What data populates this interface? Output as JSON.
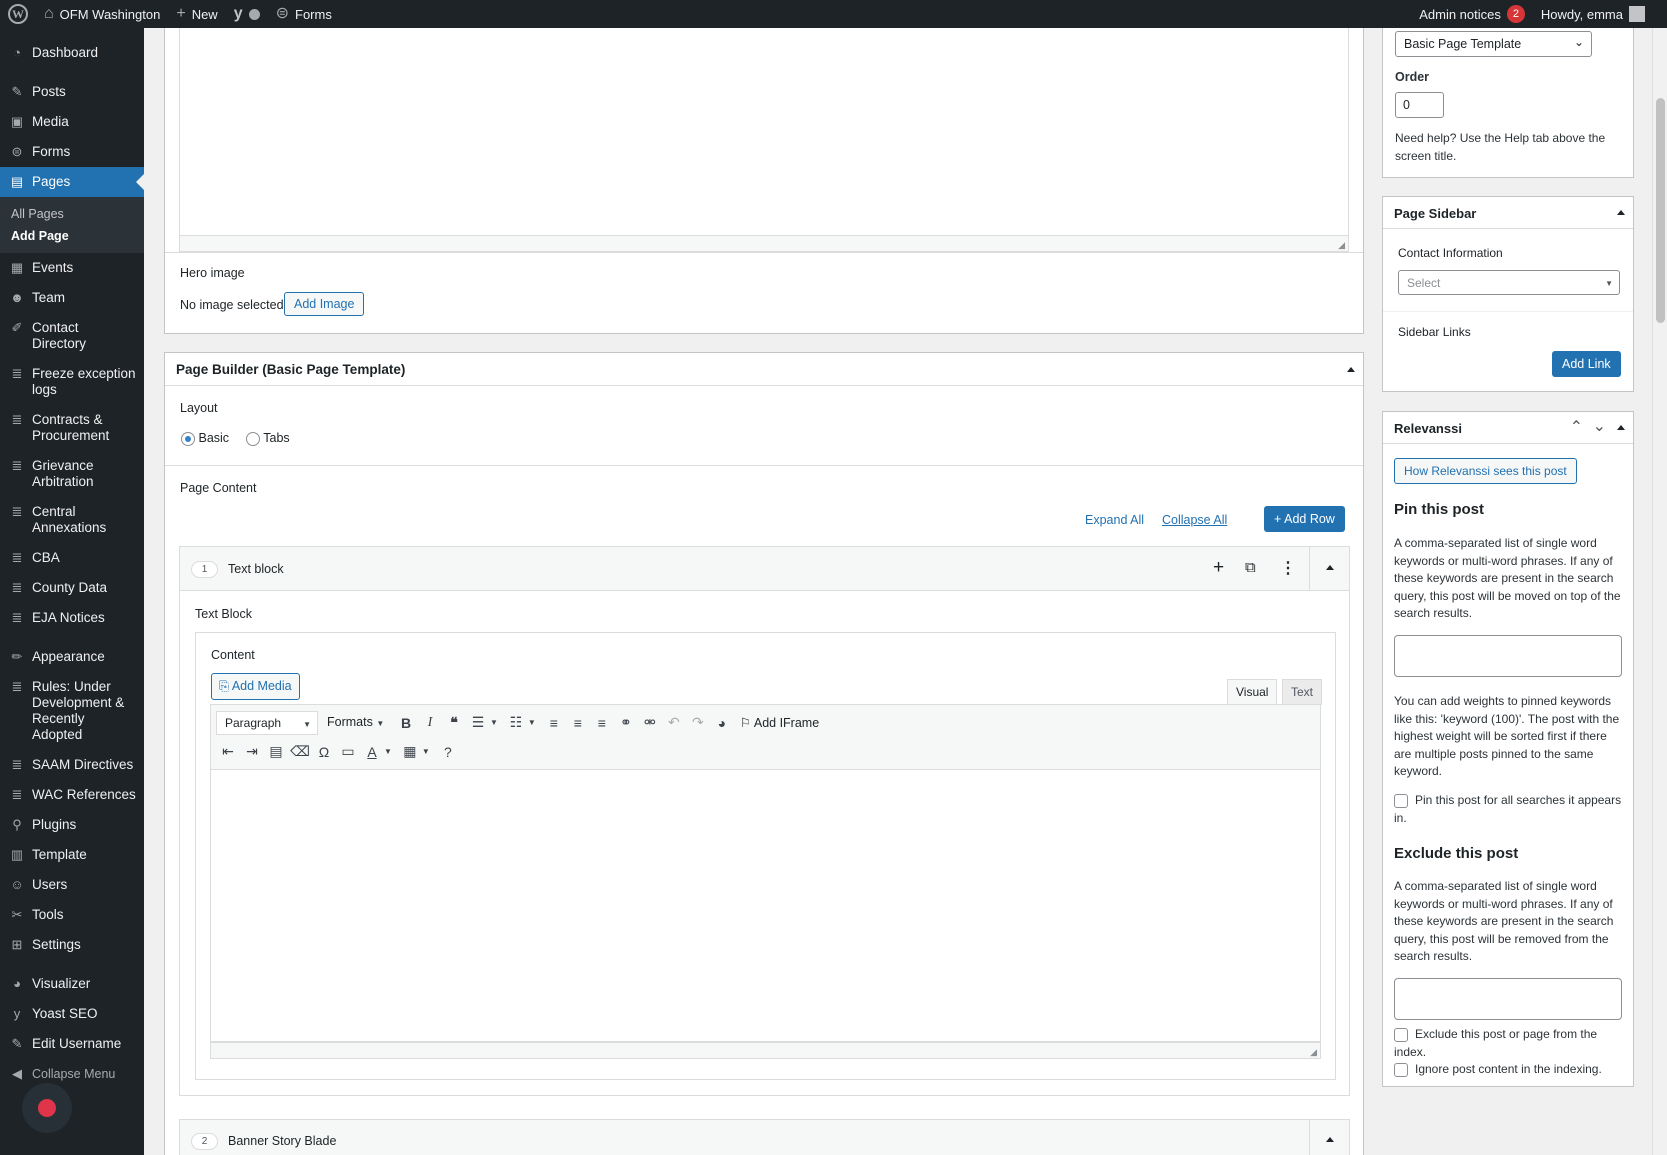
{
  "admin_bar": {
    "site_name": "OFM Washington",
    "new_label": "New",
    "forms_label": "Forms",
    "admin_notices_label": "Admin notices",
    "admin_notices_count": "2",
    "howdy": "Howdy, emma"
  },
  "menu": {
    "dashboard": "Dashboard",
    "posts": "Posts",
    "media": "Media",
    "forms": "Forms",
    "pages": "Pages",
    "all_pages": "All Pages",
    "add_page": "Add Page",
    "events": "Events",
    "team": "Team",
    "contact_directory": "Contact Directory",
    "freeze_logs": "Freeze exception logs",
    "contracts": "Contracts & Procurement",
    "grievance": "Grievance Arbitration",
    "central": "Central Annexations",
    "cba": "CBA",
    "county": "County Data",
    "eja": "EJA Notices",
    "appearance": "Appearance",
    "rules": "Rules: Under Development & Recently Adopted",
    "saam": "SAAM Directives",
    "wac": "WAC References",
    "plugins": "Plugins",
    "template": "Template",
    "users": "Users",
    "tools": "Tools",
    "settings": "Settings",
    "visualizer": "Visualizer",
    "yoast": "Yoast SEO",
    "edit_username": "Edit Username",
    "collapse": "Collapse Menu"
  },
  "hero": {
    "label": "Hero image",
    "status": "No image selected",
    "add_button": "Add Image"
  },
  "page_builder": {
    "title": "Page Builder (Basic Page Template)",
    "layout_label": "Layout",
    "layout_options": [
      "Basic",
      "Tabs"
    ],
    "layout_selected": "Basic",
    "page_content_label": "Page Content",
    "expand_all": "Expand All",
    "collapse_all": "Collapse All",
    "add_row": "Add Row",
    "rows": [
      {
        "index": "1",
        "name": "Text block"
      },
      {
        "index": "2",
        "name": "Banner Story Blade"
      }
    ],
    "text_block_label": "Text Block",
    "content_label": "Content",
    "add_media": "Add Media",
    "tab_visual": "Visual",
    "tab_text": "Text",
    "paragraph_select": "Paragraph",
    "formats": "Formats",
    "add_iframe": "Add IFrame"
  },
  "page_attributes": {
    "template_value": "Basic Page Template",
    "order_label": "Order",
    "order_value": "0",
    "help_text": "Need help? Use the Help tab above the screen title."
  },
  "page_sidebar": {
    "title": "Page Sidebar",
    "contact_label": "Contact Information",
    "contact_placeholder": "Select",
    "links_label": "Sidebar Links",
    "add_link": "Add Link"
  },
  "relevanssi": {
    "title": "Relevanssi",
    "how_button": "How Relevanssi sees this post",
    "pin_heading": "Pin this post",
    "pin_desc": "A comma-separated list of single word keywords or multi-word phrases. If any of these keywords are present in the search query, this post will be moved on top of the search results.",
    "weights_desc": "You can add weights to pinned keywords like this: 'keyword (100)'. The post with the highest weight will be sorted first if there are multiple posts pinned to the same keyword.",
    "pin_all": "Pin this post for all searches it appears in.",
    "exclude_heading": "Exclude this post",
    "exclude_desc": "A comma-separated list of single word keywords or multi-word phrases. If any of these keywords are present in the search query, this post will be removed from the search results.",
    "exclude_index": "Exclude this post or page from the index.",
    "ignore_content": "Ignore post content in the indexing."
  }
}
